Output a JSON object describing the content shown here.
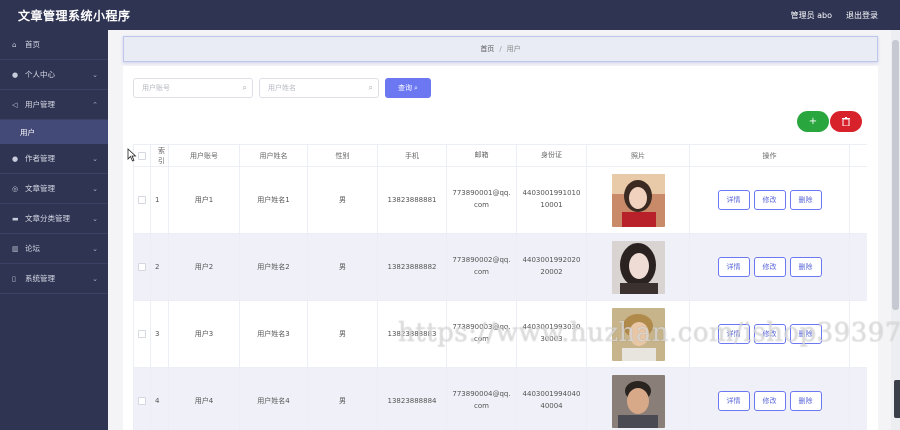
{
  "header": {
    "app_title": "文章管理系统小程序",
    "admin_label": "管理员 abo",
    "logout_label": "退出登录"
  },
  "sidebar": {
    "items": [
      {
        "label": "首页",
        "icon": "home-icon",
        "expandable": false
      },
      {
        "label": "个人中心",
        "icon": "user-icon",
        "expandable": true
      },
      {
        "label": "用户管理",
        "icon": "send-icon",
        "expandable": true,
        "expanded": true,
        "children": [
          {
            "label": "用户"
          }
        ]
      },
      {
        "label": "作者管理",
        "icon": "location-icon",
        "expandable": true
      },
      {
        "label": "文章管理",
        "icon": "compass-icon",
        "expandable": true
      },
      {
        "label": "文章分类管理",
        "icon": "monitor-icon",
        "expandable": true
      },
      {
        "label": "论坛",
        "icon": "chart-icon",
        "expandable": true
      },
      {
        "label": "系统管理",
        "icon": "phone-icon",
        "expandable": true
      }
    ]
  },
  "breadcrumb": {
    "home": "首页",
    "separator": "/",
    "current": "用户"
  },
  "search": {
    "account_placeholder": "用户账号",
    "name_placeholder": "用户姓名",
    "query_label": "查询"
  },
  "actions": {
    "add_symbol": "+",
    "delete_icon": "trash-icon",
    "add_color": "#2aa63f",
    "delete_color": "#d7212b"
  },
  "table": {
    "headers": [
      "索引",
      "用户账号",
      "用户姓名",
      "性别",
      "手机",
      "邮箱",
      "身份证",
      "照片",
      "操作"
    ],
    "op_labels": {
      "detail": "详情",
      "edit": "修改",
      "delete": "删除"
    },
    "rows": [
      {
        "index": "1",
        "account": "用户1",
        "name": "用户姓名1",
        "gender": "男",
        "phone": "13823888881",
        "email": "773890001@qq.com",
        "id_card": "440300199101010001"
      },
      {
        "index": "2",
        "account": "用户2",
        "name": "用户姓名2",
        "gender": "男",
        "phone": "13823888882",
        "email": "773890002@qq.com",
        "id_card": "440300199202020002"
      },
      {
        "index": "3",
        "account": "用户3",
        "name": "用户姓名3",
        "gender": "男",
        "phone": "13823888883",
        "email": "773890003@qq.com",
        "id_card": "440300199303030003"
      },
      {
        "index": "4",
        "account": "用户4",
        "name": "用户姓名4",
        "gender": "男",
        "phone": "13823888884",
        "email": "773890004@qq.com",
        "id_card": "440300199404040004"
      }
    ]
  },
  "watermark": "https://www.huzhan.com/ishop39397",
  "colors": {
    "nav_bg": "#2f3453",
    "accent": "#6b78f2",
    "active_submenu": "#434a78"
  }
}
